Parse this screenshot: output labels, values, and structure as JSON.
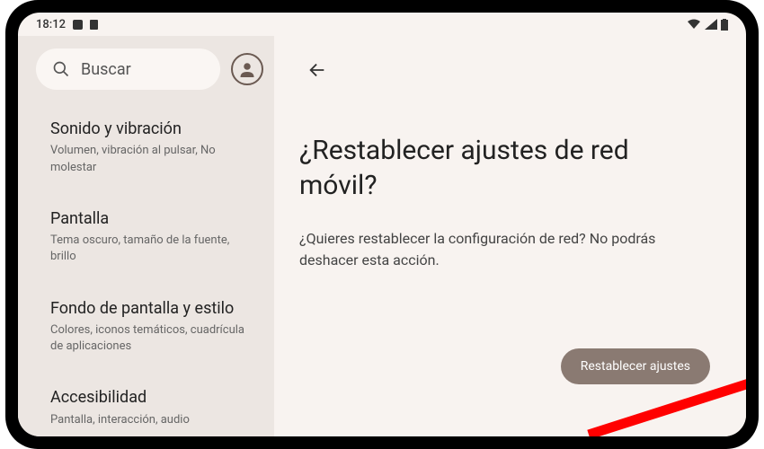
{
  "status": {
    "time": "18:12",
    "wifi": "▾",
    "signal": "◢",
    "battery": "▮"
  },
  "sidebar": {
    "search": {
      "placeholder": "Buscar"
    },
    "items": [
      {
        "title": "Sonido y vibración",
        "subtitle": "Volumen, vibración al pulsar, No molestar"
      },
      {
        "title": "Pantalla",
        "subtitle": "Tema oscuro, tamaño de la fuente, brillo"
      },
      {
        "title": "Fondo de pantalla y estilo",
        "subtitle": "Colores, iconos temáticos, cuadrícula de aplicaciones"
      },
      {
        "title": "Accesibilidad",
        "subtitle": "Pantalla, interacción, audio"
      }
    ]
  },
  "main": {
    "title": "¿Restablecer ajustes de red móvil?",
    "description": "¿Quieres restablecer la configuración de red? No podrás deshacer esta acción.",
    "button": "Restablecer ajustes"
  }
}
